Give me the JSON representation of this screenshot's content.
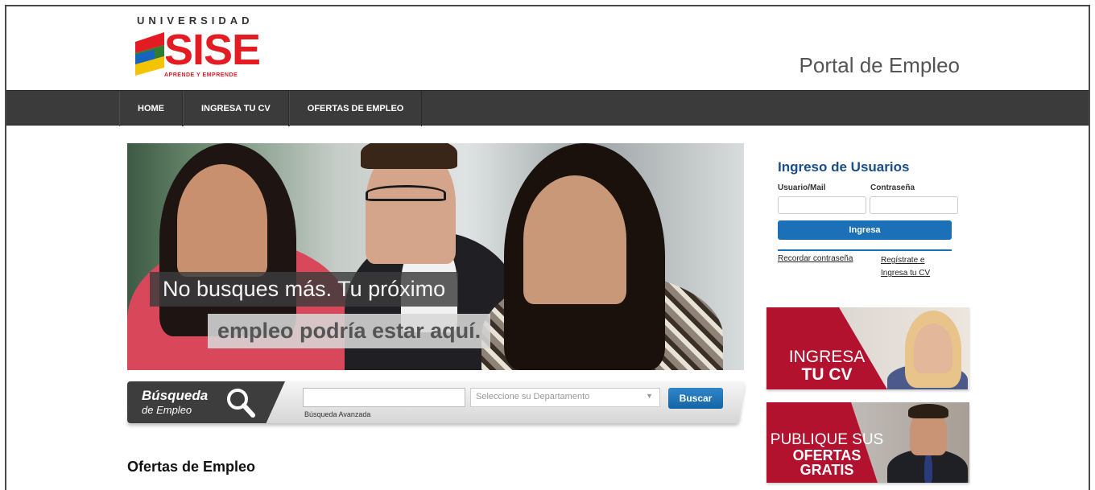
{
  "logo": {
    "top": "UNIVERSIDAD",
    "word": "SISE",
    "tagline": "APRENDE Y EMPRENDE"
  },
  "header": {
    "portal_title": "Portal de Empleo"
  },
  "nav": {
    "items": [
      {
        "label": "HOME"
      },
      {
        "label": "INGRESA TU CV"
      },
      {
        "label": "OFERTAS DE EMPLEO"
      }
    ]
  },
  "hero": {
    "line1": "No busques más. Tu próximo",
    "line2": "empleo podría estar aquí."
  },
  "search": {
    "label_main": "Búsqueda",
    "label_sub": "de Empleo",
    "input_value": "",
    "advanced_link": "Búsqueda Avanzada",
    "department_placeholder": "Seleccione su Departamento",
    "button_label": "Buscar"
  },
  "offers": {
    "title": "Ofertas de Empleo"
  },
  "login": {
    "title": "Ingreso de Usuarios",
    "user_label": "Usuario/Mail",
    "password_label": "Contraseña",
    "button_label": "Ingresa",
    "forgot_link": "Recordar contraseña",
    "register_link": "Regístrate e Ingresa tu CV"
  },
  "banners": {
    "cv": {
      "line1": "INGRESA",
      "line2": "TU CV"
    },
    "offers": {
      "line1": "PUBLIQUE SUS",
      "line2": "OFERTAS",
      "line3": "GRATIS"
    }
  },
  "colors": {
    "brand_red": "#e31b23",
    "nav_bg": "#3b3b3b",
    "accent_blue": "#1b70b8",
    "login_title": "#1a4d8c",
    "banner_red": "#b3122e"
  },
  "icons": {
    "search": "magnifier-icon",
    "select_caret": "caret-down-icon"
  }
}
